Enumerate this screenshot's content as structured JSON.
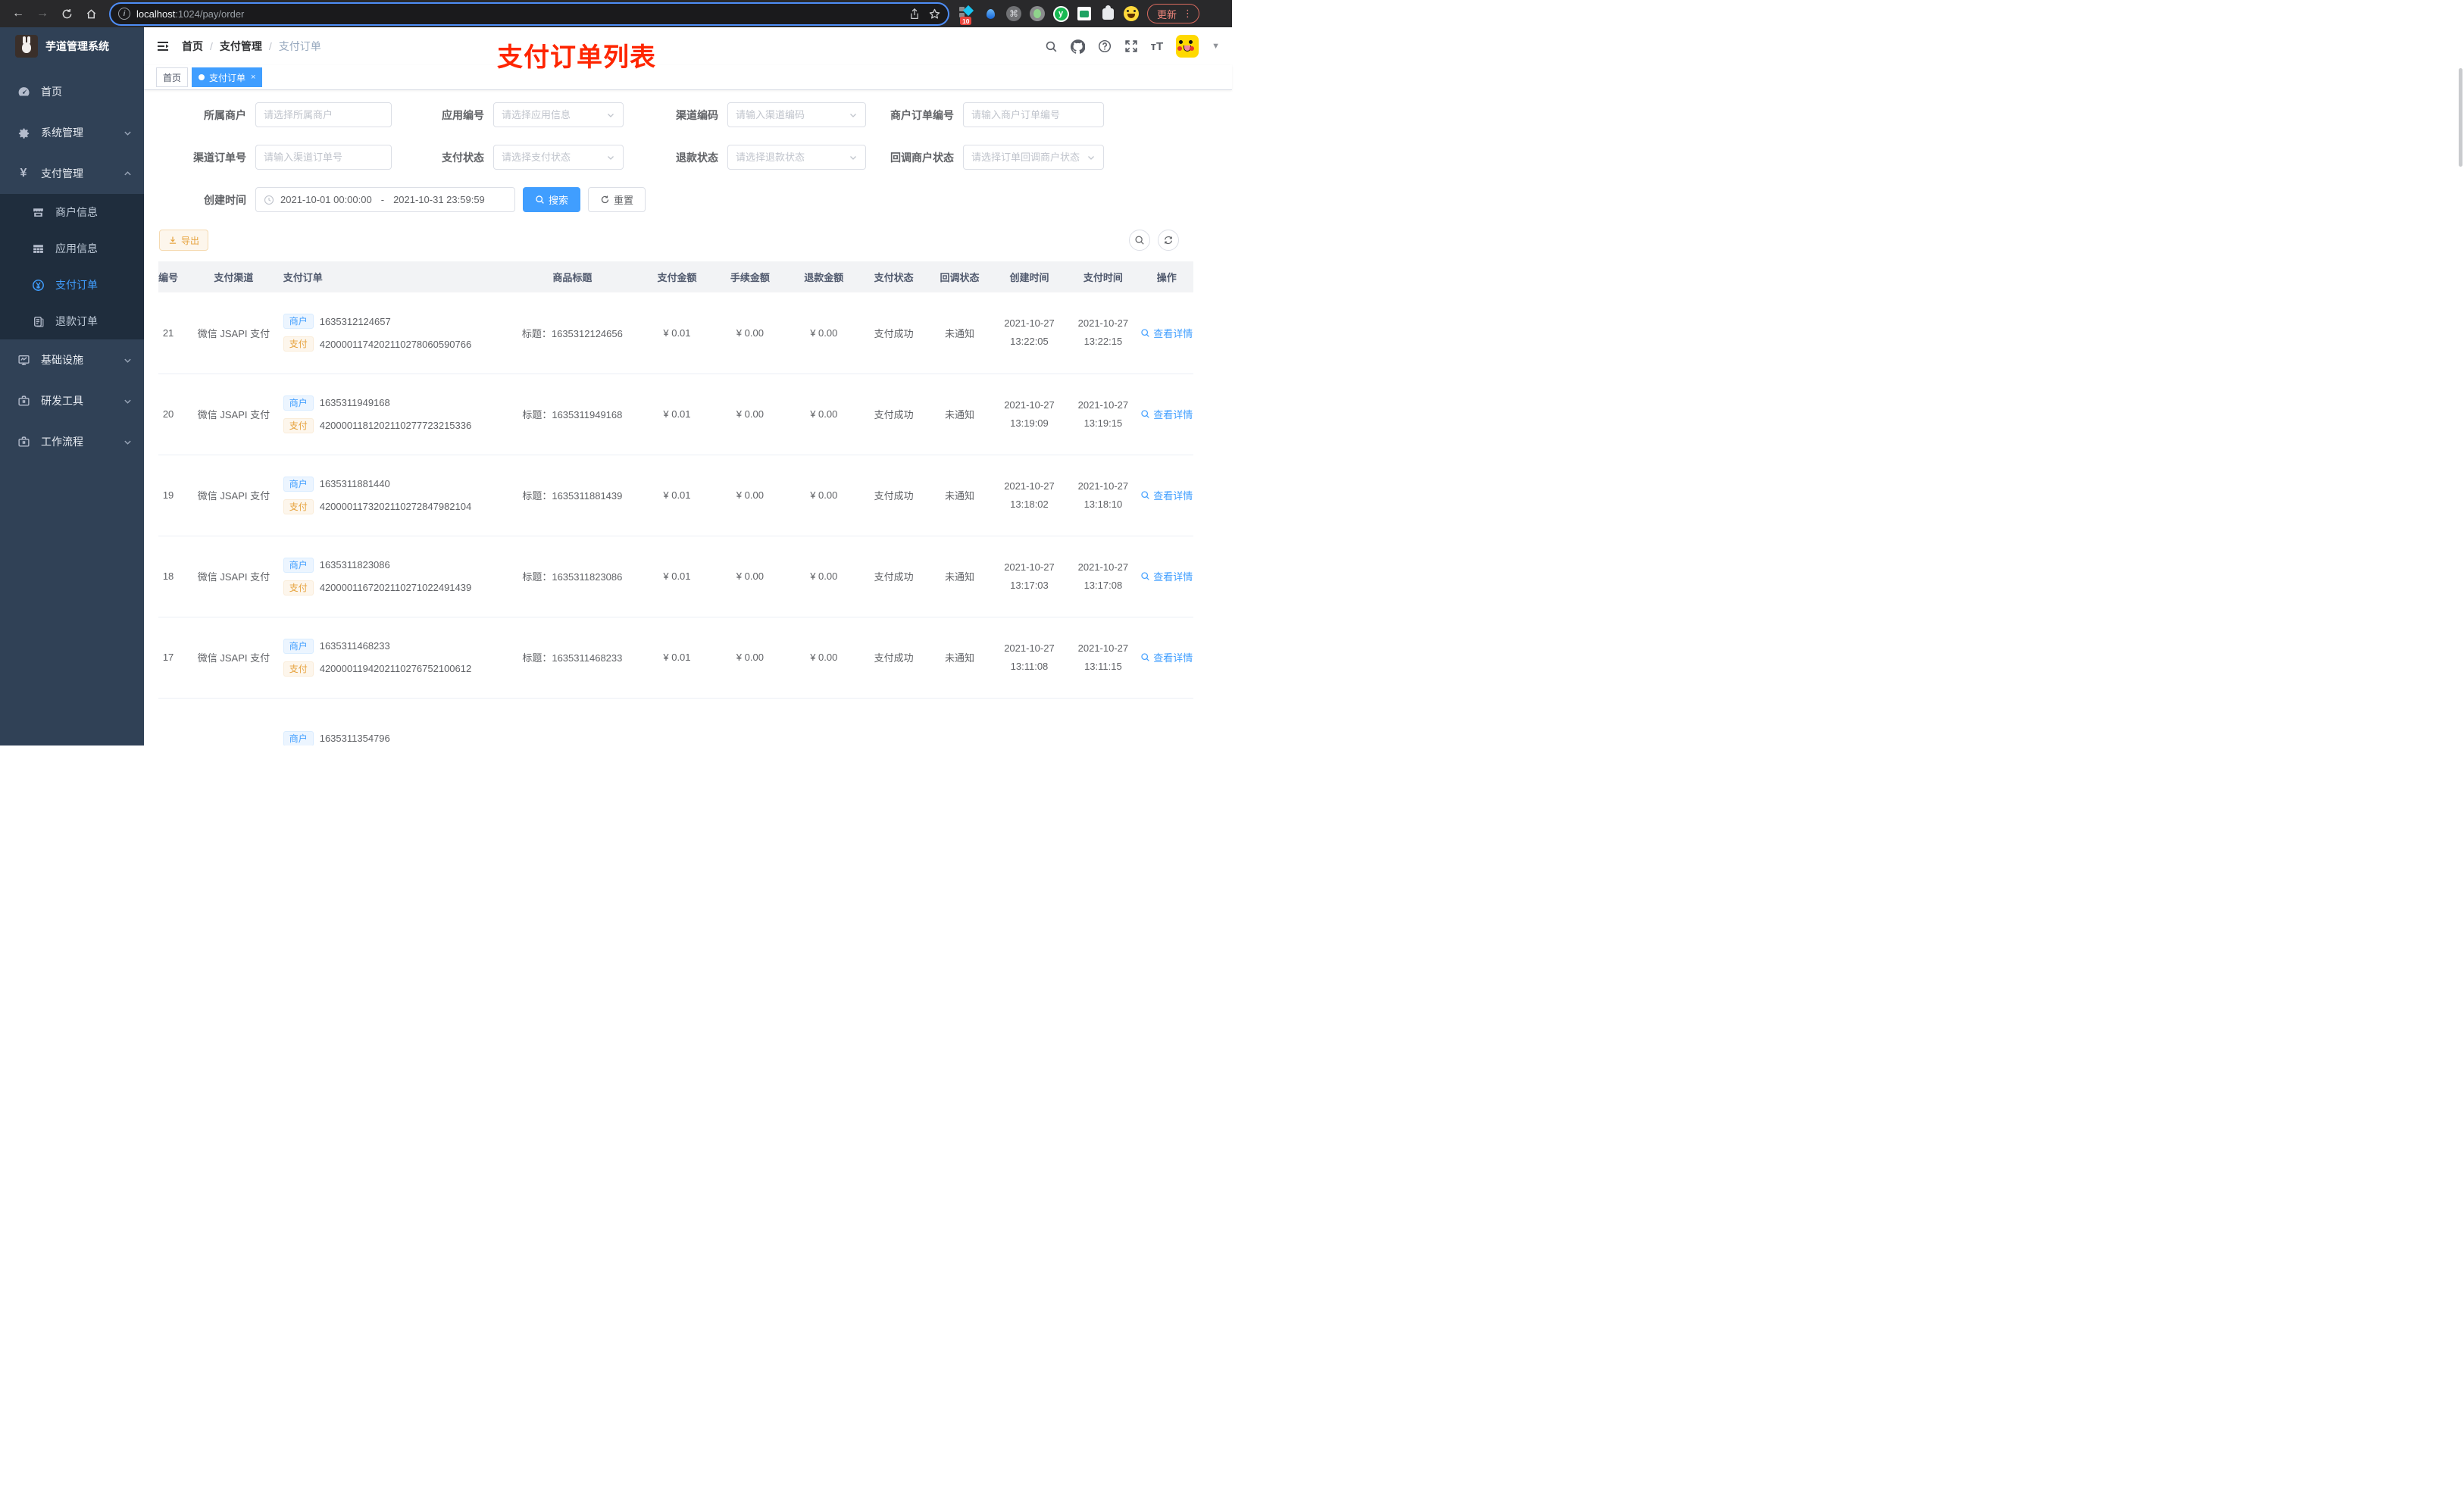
{
  "colors": {
    "accent": "#409EFF",
    "annotation_red": "#FE2500",
    "warning": "#E6A23C",
    "sidebar_bg": "#304156",
    "submenu_bg": "#1F2D3D"
  },
  "browser": {
    "url_host": "localhost",
    "url_path": ":1024/pay/order",
    "extension_badge": "10",
    "update_label": "更新"
  },
  "header": {
    "breadcrumb": {
      "home": "首页",
      "section": "支付管理",
      "current": "支付订单"
    },
    "annotation": "支付订单列表"
  },
  "tabs": {
    "home": {
      "label": "首页"
    },
    "current": {
      "label": "支付订单"
    }
  },
  "sidebar": {
    "logo_title": "芋道管理系统",
    "items": {
      "home": "首页",
      "system": "系统管理",
      "payment": "支付管理",
      "infra": "基础设施",
      "devtools": "研发工具",
      "workflow": "工作流程"
    },
    "payment_children": {
      "merchant": "商户信息",
      "app": "应用信息",
      "pay_order": "支付订单",
      "refund_order": "退款订单"
    }
  },
  "filters": {
    "fields": [
      {
        "label": "所属商户",
        "placeholder": "请选择所属商户",
        "type": "input"
      },
      {
        "label": "应用编号",
        "placeholder": "请选择应用信息",
        "type": "select"
      },
      {
        "label": "渠道编码",
        "placeholder": "请输入渠道编码",
        "type": "select"
      },
      {
        "label": "商户订单编号",
        "placeholder": "请输入商户订单编号",
        "type": "input"
      },
      {
        "label": "渠道订单号",
        "placeholder": "请输入渠道订单号",
        "type": "input"
      },
      {
        "label": "支付状态",
        "placeholder": "请选择支付状态",
        "type": "select"
      },
      {
        "label": "退款状态",
        "placeholder": "请选择退款状态",
        "type": "select"
      },
      {
        "label": "回调商户状态",
        "placeholder": "请选择订单回调商户状态",
        "type": "select"
      }
    ],
    "create_time": {
      "label": "创建时间",
      "start": "2021-10-01 00:00:00",
      "separator": "-",
      "end": "2021-10-31 23:59:59"
    },
    "search_label": "搜索",
    "reset_label": "重置"
  },
  "toolbar": {
    "export_label": "导出"
  },
  "table": {
    "columns": [
      "编号",
      "支付渠道",
      "支付订单",
      "商品标题",
      "支付金额",
      "手续金额",
      "退款金额",
      "支付状态",
      "回调状态",
      "创建时间",
      "支付时间",
      "操作"
    ],
    "merchant_tag": "商户",
    "pay_tag": "支付",
    "title_prefix": "标题：",
    "action_label": "查看详情",
    "rows": [
      {
        "id": "21",
        "channel": "微信 JSAPI 支付",
        "merchant_no": "1635312124657",
        "pay_no": "4200001174202110278060590766",
        "title": "1635312124656",
        "amount": "¥ 0.01",
        "fee": "¥ 0.00",
        "refund": "¥ 0.00",
        "status": "支付成功",
        "notify": "未通知",
        "create_date": "2021-10-27",
        "create_time": "13:22:05",
        "pay_date": "2021-10-27",
        "pay_time": "13:22:15"
      },
      {
        "id": "20",
        "channel": "微信 JSAPI 支付",
        "merchant_no": "1635311949168",
        "pay_no": "4200001181202110277723215336",
        "title": "1635311949168",
        "amount": "¥ 0.01",
        "fee": "¥ 0.00",
        "refund": "¥ 0.00",
        "status": "支付成功",
        "notify": "未通知",
        "create_date": "2021-10-27",
        "create_time": "13:19:09",
        "pay_date": "2021-10-27",
        "pay_time": "13:19:15"
      },
      {
        "id": "19",
        "channel": "微信 JSAPI 支付",
        "merchant_no": "1635311881440",
        "pay_no": "4200001173202110272847982104",
        "title": "1635311881439",
        "amount": "¥ 0.01",
        "fee": "¥ 0.00",
        "refund": "¥ 0.00",
        "status": "支付成功",
        "notify": "未通知",
        "create_date": "2021-10-27",
        "create_time": "13:18:02",
        "pay_date": "2021-10-27",
        "pay_time": "13:18:10"
      },
      {
        "id": "18",
        "channel": "微信 JSAPI 支付",
        "merchant_no": "1635311823086",
        "pay_no": "4200001167202110271022491439",
        "title": "1635311823086",
        "amount": "¥ 0.01",
        "fee": "¥ 0.00",
        "refund": "¥ 0.00",
        "status": "支付成功",
        "notify": "未通知",
        "create_date": "2021-10-27",
        "create_time": "13:17:03",
        "pay_date": "2021-10-27",
        "pay_time": "13:17:08"
      },
      {
        "id": "17",
        "channel": "微信 JSAPI 支付",
        "merchant_no": "1635311468233",
        "pay_no": "4200001194202110276752100612",
        "title": "1635311468233",
        "amount": "¥ 0.01",
        "fee": "¥ 0.00",
        "refund": "¥ 0.00",
        "status": "支付成功",
        "notify": "未通知",
        "create_date": "2021-10-27",
        "create_time": "13:11:08",
        "pay_date": "2021-10-27",
        "pay_time": "13:11:15"
      },
      {
        "partial": true,
        "merchant_no": "1635311354796"
      }
    ]
  }
}
